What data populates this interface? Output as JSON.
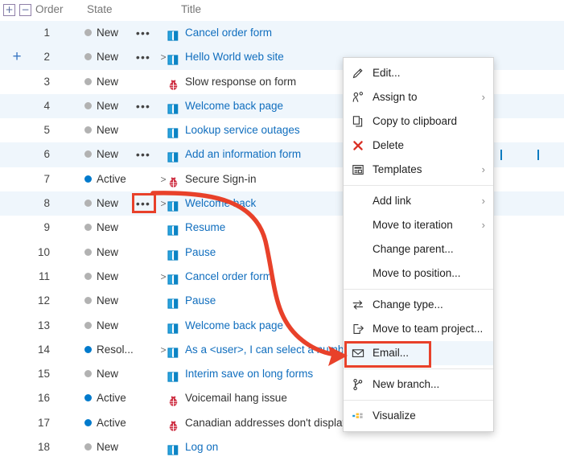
{
  "grid": {
    "header": {
      "expand_all": "+",
      "collapse_all": "−",
      "order": "Order",
      "state": "State",
      "title": "Title"
    },
    "rows": [
      {
        "order": "1",
        "state": "New",
        "state_kind": "new",
        "dots": "•••",
        "chevron": "",
        "icon": "backlog-item-icon",
        "title": "Cancel order form",
        "shaded": true,
        "add": ""
      },
      {
        "order": "2",
        "state": "New",
        "state_kind": "new",
        "dots": "•••",
        "chevron": ">",
        "icon": "backlog-item-icon",
        "title": "Hello World web site",
        "shaded": true,
        "add": "+"
      },
      {
        "order": "3",
        "state": "New",
        "state_kind": "new",
        "dots": "",
        "chevron": "",
        "icon": "bug-icon",
        "title": "Slow response on form",
        "shaded": false,
        "add": ""
      },
      {
        "order": "4",
        "state": "New",
        "state_kind": "new",
        "dots": "•••",
        "chevron": "",
        "icon": "backlog-item-icon",
        "title": "Welcome back page",
        "shaded": true,
        "add": ""
      },
      {
        "order": "5",
        "state": "New",
        "state_kind": "new",
        "dots": "",
        "chevron": "",
        "icon": "backlog-item-icon",
        "title": "Lookup service outages",
        "shaded": false,
        "add": ""
      },
      {
        "order": "6",
        "state": "New",
        "state_kind": "new",
        "dots": "•••",
        "chevron": "",
        "icon": "backlog-item-icon",
        "title": "Add an information form",
        "shaded": true,
        "add": ""
      },
      {
        "order": "7",
        "state": "Active",
        "state_kind": "active",
        "dots": "",
        "chevron": ">",
        "icon": "bug-icon",
        "title": "Secure Sign-in",
        "shaded": false,
        "add": ""
      },
      {
        "order": "8",
        "state": "New",
        "state_kind": "new",
        "dots": "•••",
        "chevron": ">",
        "icon": "backlog-item-icon",
        "title": "Welcome back",
        "shaded": true,
        "add": ""
      },
      {
        "order": "9",
        "state": "New",
        "state_kind": "new",
        "dots": "",
        "chevron": "",
        "icon": "backlog-item-icon",
        "title": "Resume",
        "shaded": false,
        "add": ""
      },
      {
        "order": "10",
        "state": "New",
        "state_kind": "new",
        "dots": "",
        "chevron": "",
        "icon": "backlog-item-icon",
        "title": "Pause",
        "shaded": false,
        "add": ""
      },
      {
        "order": "11",
        "state": "New",
        "state_kind": "new",
        "dots": "",
        "chevron": ">",
        "icon": "backlog-item-icon",
        "title": "Cancel order form",
        "shaded": false,
        "add": ""
      },
      {
        "order": "12",
        "state": "New",
        "state_kind": "new",
        "dots": "",
        "chevron": "",
        "icon": "backlog-item-icon",
        "title": "Pause",
        "shaded": false,
        "add": ""
      },
      {
        "order": "13",
        "state": "New",
        "state_kind": "new",
        "dots": "",
        "chevron": "",
        "icon": "backlog-item-icon",
        "title": "Welcome back page",
        "shaded": false,
        "add": ""
      },
      {
        "order": "14",
        "state": "Resol...",
        "state_kind": "resolved",
        "dots": "",
        "chevron": ">",
        "icon": "backlog-item-icon",
        "title": "As a <user>, I can select a numbe",
        "shaded": false,
        "add": ""
      },
      {
        "order": "15",
        "state": "New",
        "state_kind": "new",
        "dots": "",
        "chevron": "",
        "icon": "backlog-item-icon",
        "title": "Interim save on long forms",
        "shaded": false,
        "add": ""
      },
      {
        "order": "16",
        "state": "Active",
        "state_kind": "active",
        "dots": "",
        "chevron": "",
        "icon": "bug-icon",
        "title": "Voicemail hang issue",
        "shaded": false,
        "add": ""
      },
      {
        "order": "17",
        "state": "Active",
        "state_kind": "active",
        "dots": "",
        "chevron": "",
        "icon": "bug-icon",
        "title": "Canadian addresses don't display",
        "shaded": false,
        "add": ""
      },
      {
        "order": "18",
        "state": "New",
        "state_kind": "new",
        "dots": "",
        "chevron": "",
        "icon": "backlog-item-icon",
        "title": "Log on",
        "shaded": false,
        "add": ""
      }
    ]
  },
  "context_menu": {
    "groups": [
      {
        "items": [
          {
            "label": "Edit...",
            "icon": "pencil-icon",
            "submenu": ""
          },
          {
            "label": "Assign to",
            "icon": "assign-person-icon",
            "submenu": "›"
          },
          {
            "label": "Copy to clipboard",
            "icon": "copy-icon",
            "submenu": ""
          },
          {
            "label": "Delete",
            "icon": "delete-x-icon",
            "submenu": ""
          },
          {
            "label": "Templates",
            "icon": "templates-icon",
            "submenu": "›"
          }
        ]
      },
      {
        "items": [
          {
            "label": "Add link",
            "icon": "",
            "submenu": "›"
          },
          {
            "label": "Move to iteration",
            "icon": "",
            "submenu": "›"
          },
          {
            "label": "Change parent...",
            "icon": "",
            "submenu": ""
          },
          {
            "label": "Move to position...",
            "icon": "",
            "submenu": ""
          }
        ]
      },
      {
        "items": [
          {
            "label": "Change type...",
            "icon": "change-type-icon",
            "submenu": ""
          },
          {
            "label": "Move to team project...",
            "icon": "move-to-project-icon",
            "submenu": ""
          },
          {
            "label": "Email...",
            "icon": "envelope-icon",
            "submenu": "",
            "highlighted": true
          }
        ]
      },
      {
        "items": [
          {
            "label": "New branch...",
            "icon": "branch-icon",
            "submenu": ""
          }
        ]
      },
      {
        "items": [
          {
            "label": "Visualize",
            "icon": "visualize-icon",
            "submenu": ""
          }
        ]
      }
    ]
  },
  "annotations": {
    "highlight_color": "#e8412a",
    "source_label": "context-menu-ellipsis-button",
    "target_label": "Email..."
  },
  "colors": {
    "link": "#106ebe",
    "row_shaded": "#eff6fc",
    "state_new": "#b2b2b2",
    "state_active": "#007acc",
    "bug": "#cc293d",
    "annotation_red": "#e8412a"
  }
}
